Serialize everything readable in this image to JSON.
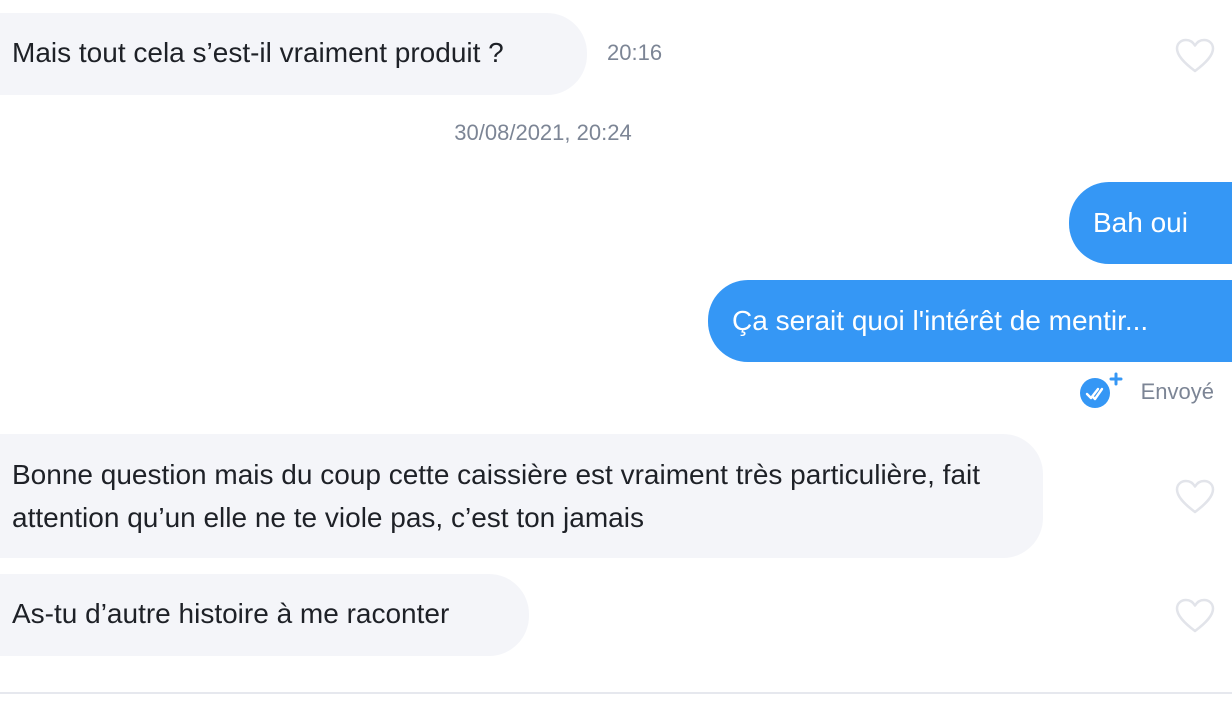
{
  "messages": {
    "m1": {
      "text": "Mais tout cela s’est-il vraiment produit ?",
      "time": "20:16"
    },
    "date_separator": "30/08/2021, 20:24",
    "m2": {
      "text": "Bah oui"
    },
    "m3": {
      "text": "Ça serait quoi l'intérêt de mentir..."
    },
    "sent_status": "Envoyé",
    "m4": {
      "text": "Bonne question mais du coup cette caissière est vraiment très particulière, fait attention qu’un elle ne te viole pas, c’est ton jamais"
    },
    "m5": {
      "text": "As-tu d’autre histoire à me raconter"
    }
  },
  "colors": {
    "outgoing_bubble": "#3597f5",
    "incoming_bubble": "#f4f5f9",
    "meta_text": "#7c8595",
    "heart_outline": "#e2e4ea"
  },
  "icons": {
    "like": "heart-outline-icon",
    "sent": "double-check-icon"
  }
}
